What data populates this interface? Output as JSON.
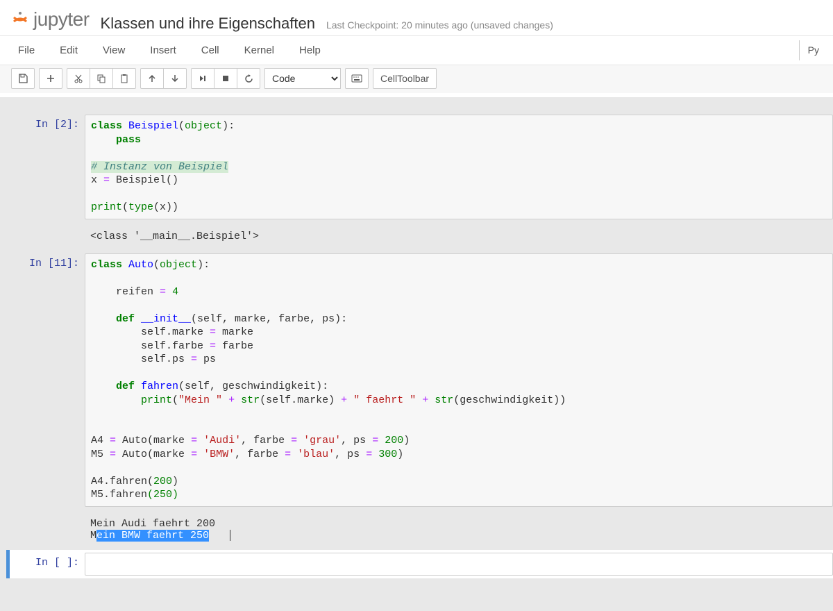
{
  "header": {
    "logo_text": "jupyter",
    "notebook_title": "Klassen und ihre Eigenschaften",
    "checkpoint": "Last Checkpoint: 20 minutes ago (unsaved changes)"
  },
  "menu": {
    "items": [
      "File",
      "Edit",
      "View",
      "Insert",
      "Cell",
      "Kernel",
      "Help"
    ],
    "kernel_indicator": "Py"
  },
  "toolbar": {
    "celltype_selected": "Code",
    "celltoolbar_label": "CellToolbar"
  },
  "cells": [
    {
      "prompt": "In [2]:",
      "code_tokens": [
        {
          "t": "class ",
          "c": "kw"
        },
        {
          "t": "Beispiel",
          "c": "cls"
        },
        {
          "t": "("
        },
        {
          "t": "object",
          "c": "builtin"
        },
        {
          "t": "):\n"
        },
        {
          "t": "    "
        },
        {
          "t": "pass",
          "c": "kw"
        },
        {
          "t": "\n\n"
        },
        {
          "t": "# Instanz von Beispiel",
          "c": "comment",
          "hl": true
        },
        {
          "t": "\n"
        },
        {
          "t": "x "
        },
        {
          "t": "=",
          "c": "op"
        },
        {
          "t": " Beispiel()\n\n"
        },
        {
          "t": "print",
          "c": "builtin"
        },
        {
          "t": "("
        },
        {
          "t": "type",
          "c": "builtin"
        },
        {
          "t": "(x))"
        }
      ],
      "output": "<class '__main__.Beispiel'>"
    },
    {
      "prompt": "In [11]:",
      "code_tokens": [
        {
          "t": "class ",
          "c": "kw"
        },
        {
          "t": "Auto",
          "c": "cls"
        },
        {
          "t": "("
        },
        {
          "t": "object",
          "c": "builtin"
        },
        {
          "t": "):\n\n"
        },
        {
          "t": "    reifen "
        },
        {
          "t": "=",
          "c": "op"
        },
        {
          "t": " "
        },
        {
          "t": "4",
          "c": "num"
        },
        {
          "t": "\n\n"
        },
        {
          "t": "    "
        },
        {
          "t": "def ",
          "c": "kw"
        },
        {
          "t": "__init__",
          "c": "func"
        },
        {
          "t": "(self, marke, farbe, ps):\n"
        },
        {
          "t": "        self.marke "
        },
        {
          "t": "=",
          "c": "op"
        },
        {
          "t": " marke\n"
        },
        {
          "t": "        self.farbe "
        },
        {
          "t": "=",
          "c": "op"
        },
        {
          "t": " farbe\n"
        },
        {
          "t": "        self.ps "
        },
        {
          "t": "=",
          "c": "op"
        },
        {
          "t": " ps\n\n"
        },
        {
          "t": "    "
        },
        {
          "t": "def ",
          "c": "kw"
        },
        {
          "t": "fahren",
          "c": "func"
        },
        {
          "t": "(self, geschwindigkeit):\n"
        },
        {
          "t": "        "
        },
        {
          "t": "print",
          "c": "builtin"
        },
        {
          "t": "("
        },
        {
          "t": "\"Mein \"",
          "c": "str"
        },
        {
          "t": " "
        },
        {
          "t": "+",
          "c": "op"
        },
        {
          "t": " "
        },
        {
          "t": "str",
          "c": "builtin"
        },
        {
          "t": "(self.marke) "
        },
        {
          "t": "+",
          "c": "op"
        },
        {
          "t": " "
        },
        {
          "t": "\" faehrt \"",
          "c": "str"
        },
        {
          "t": " "
        },
        {
          "t": "+",
          "c": "op"
        },
        {
          "t": " "
        },
        {
          "t": "str",
          "c": "builtin"
        },
        {
          "t": "(geschwindigkeit))\n\n\n"
        },
        {
          "t": "A4 "
        },
        {
          "t": "=",
          "c": "op"
        },
        {
          "t": " Auto(marke "
        },
        {
          "t": "=",
          "c": "op"
        },
        {
          "t": " "
        },
        {
          "t": "'Audi'",
          "c": "str"
        },
        {
          "t": ", farbe "
        },
        {
          "t": "=",
          "c": "op"
        },
        {
          "t": " "
        },
        {
          "t": "'grau'",
          "c": "str"
        },
        {
          "t": ", ps "
        },
        {
          "t": "=",
          "c": "op"
        },
        {
          "t": " "
        },
        {
          "t": "200",
          "c": "num"
        },
        {
          "t": ")\n"
        },
        {
          "t": "M5 "
        },
        {
          "t": "=",
          "c": "op"
        },
        {
          "t": " Auto(marke "
        },
        {
          "t": "=",
          "c": "op"
        },
        {
          "t": " "
        },
        {
          "t": "'BMW'",
          "c": "str"
        },
        {
          "t": ", farbe "
        },
        {
          "t": "=",
          "c": "op"
        },
        {
          "t": " "
        },
        {
          "t": "'blau'",
          "c": "str"
        },
        {
          "t": ", ps "
        },
        {
          "t": "=",
          "c": "op"
        },
        {
          "t": " "
        },
        {
          "t": "300",
          "c": "num"
        },
        {
          "t": ")\n\n"
        },
        {
          "t": "A4.fahren("
        },
        {
          "t": "200",
          "c": "num"
        },
        {
          "t": ")\n"
        },
        {
          "t": "M5.fahren"
        },
        {
          "t": "(",
          "c": "num"
        },
        {
          "t": "250",
          "c": "num"
        },
        {
          "t": ")",
          "c": "num"
        }
      ],
      "output_parts": [
        {
          "t": "Mein Audi faehrt 200\n"
        },
        {
          "t": "M"
        },
        {
          "t": "ein BMW faehrt 250",
          "sel": true
        }
      ]
    },
    {
      "prompt": "In [ ]:",
      "code_tokens": [],
      "selected": true
    }
  ]
}
